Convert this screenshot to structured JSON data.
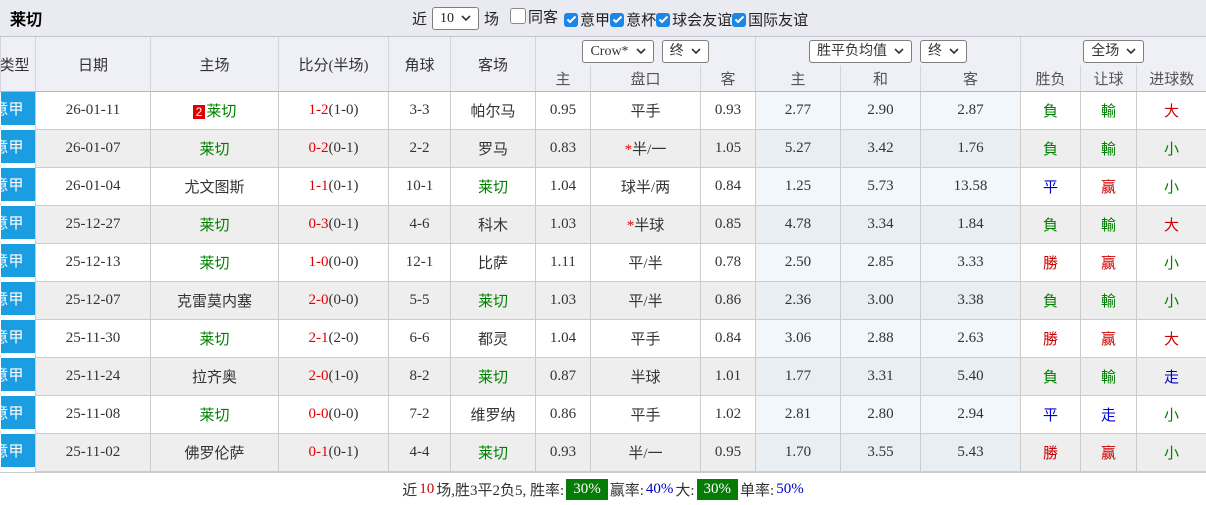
{
  "title": "莱切",
  "filter": {
    "near_label": "近",
    "count": "10",
    "matches_label": "场",
    "checkboxes": [
      {
        "label": "同客",
        "checked": false
      },
      {
        "label": "意甲",
        "checked": true
      },
      {
        "label": "意杯",
        "checked": true
      },
      {
        "label": "球会友谊",
        "checked": true
      },
      {
        "label": "国际友谊",
        "checked": true
      }
    ]
  },
  "table": {
    "selects": {
      "company": "Crow*",
      "stage1": "终",
      "avg": "胜平负均值",
      "stage2": "终",
      "scope": "全场"
    },
    "headers": {
      "type": "类型",
      "date": "日期",
      "home": "主场",
      "score": "比分(半场)",
      "corner": "角球",
      "away": "客场",
      "sub": [
        "主",
        "盘口",
        "客",
        "主",
        "和",
        "客",
        "胜负",
        "让球",
        "进球数"
      ]
    },
    "rows": [
      {
        "league": "意甲",
        "date": "26-01-11",
        "home": {
          "text": "莱切",
          "cls": "g",
          "badge": "2"
        },
        "score": "1-2",
        "half": "(1-0)",
        "corner": "3-3",
        "away": {
          "text": "帕尔马",
          "cls": "k"
        },
        "o1": "0.95",
        "hc": {
          "star": false,
          "text": "平手"
        },
        "o2": "0.93",
        "a1": "2.77",
        "a2": "2.90",
        "a3": "2.87",
        "res": {
          "t": "負",
          "c": "g"
        },
        "hres": {
          "t": "輸",
          "c": "g"
        },
        "gres": {
          "t": "大",
          "c": "r"
        }
      },
      {
        "league": "意甲",
        "date": "26-01-07",
        "home": {
          "text": "莱切",
          "cls": "g",
          "badge": null
        },
        "score": "0-2",
        "half": "(0-1)",
        "corner": "2-2",
        "away": {
          "text": "罗马",
          "cls": "k"
        },
        "o1": "0.83",
        "hc": {
          "star": true,
          "text": "半/一"
        },
        "o2": "1.05",
        "a1": "5.27",
        "a2": "3.42",
        "a3": "1.76",
        "res": {
          "t": "負",
          "c": "g"
        },
        "hres": {
          "t": "輸",
          "c": "g"
        },
        "gres": {
          "t": "小",
          "c": "g"
        }
      },
      {
        "league": "意甲",
        "date": "26-01-04",
        "home": {
          "text": "尤文图斯",
          "cls": "k",
          "badge": null
        },
        "score": "1-1",
        "half": "(0-1)",
        "corner": "10-1",
        "away": {
          "text": "莱切",
          "cls": "g"
        },
        "o1": "1.04",
        "hc": {
          "star": false,
          "text": "球半/两"
        },
        "o2": "0.84",
        "a1": "1.25",
        "a2": "5.73",
        "a3": "13.58",
        "res": {
          "t": "平",
          "c": "b"
        },
        "hres": {
          "t": "赢",
          "c": "r"
        },
        "gres": {
          "t": "小",
          "c": "g"
        }
      },
      {
        "league": "意甲",
        "date": "25-12-27",
        "home": {
          "text": "莱切",
          "cls": "g",
          "badge": null
        },
        "score": "0-3",
        "half": "(0-1)",
        "corner": "4-6",
        "away": {
          "text": "科木",
          "cls": "k"
        },
        "o1": "1.03",
        "hc": {
          "star": true,
          "text": "半球"
        },
        "o2": "0.85",
        "a1": "4.78",
        "a2": "3.34",
        "a3": "1.84",
        "res": {
          "t": "負",
          "c": "g"
        },
        "hres": {
          "t": "輸",
          "c": "g"
        },
        "gres": {
          "t": "大",
          "c": "r"
        }
      },
      {
        "league": "意甲",
        "date": "25-12-13",
        "home": {
          "text": "莱切",
          "cls": "g",
          "badge": null
        },
        "score": "1-0",
        "half": "(0-0)",
        "corner": "12-1",
        "away": {
          "text": "比萨",
          "cls": "k"
        },
        "o1": "1.11",
        "hc": {
          "star": false,
          "text": "平/半"
        },
        "o2": "0.78",
        "a1": "2.50",
        "a2": "2.85",
        "a3": "3.33",
        "res": {
          "t": "勝",
          "c": "r"
        },
        "hres": {
          "t": "赢",
          "c": "r"
        },
        "gres": {
          "t": "小",
          "c": "g"
        }
      },
      {
        "league": "意甲",
        "date": "25-12-07",
        "home": {
          "text": "克雷莫内塞",
          "cls": "k",
          "badge": null
        },
        "score": "2-0",
        "half": "(0-0)",
        "corner": "5-5",
        "away": {
          "text": "莱切",
          "cls": "g"
        },
        "o1": "1.03",
        "hc": {
          "star": false,
          "text": "平/半"
        },
        "o2": "0.86",
        "a1": "2.36",
        "a2": "3.00",
        "a3": "3.38",
        "res": {
          "t": "負",
          "c": "g"
        },
        "hres": {
          "t": "輸",
          "c": "g"
        },
        "gres": {
          "t": "小",
          "c": "g"
        }
      },
      {
        "league": "意甲",
        "date": "25-11-30",
        "home": {
          "text": "莱切",
          "cls": "g",
          "badge": null
        },
        "score": "2-1",
        "half": "(2-0)",
        "corner": "6-6",
        "away": {
          "text": "都灵",
          "cls": "k"
        },
        "o1": "1.04",
        "hc": {
          "star": false,
          "text": "平手"
        },
        "o2": "0.84",
        "a1": "3.06",
        "a2": "2.88",
        "a3": "2.63",
        "res": {
          "t": "勝",
          "c": "r"
        },
        "hres": {
          "t": "赢",
          "c": "r"
        },
        "gres": {
          "t": "大",
          "c": "r"
        }
      },
      {
        "league": "意甲",
        "date": "25-11-24",
        "home": {
          "text": "拉齐奥",
          "cls": "k",
          "badge": null
        },
        "score": "2-0",
        "half": "(1-0)",
        "corner": "8-2",
        "away": {
          "text": "莱切",
          "cls": "g"
        },
        "o1": "0.87",
        "hc": {
          "star": false,
          "text": "半球"
        },
        "o2": "1.01",
        "a1": "1.77",
        "a2": "3.31",
        "a3": "5.40",
        "res": {
          "t": "負",
          "c": "g"
        },
        "hres": {
          "t": "輸",
          "c": "g"
        },
        "gres": {
          "t": "走",
          "c": "b"
        }
      },
      {
        "league": "意甲",
        "date": "25-11-08",
        "home": {
          "text": "莱切",
          "cls": "g",
          "badge": null
        },
        "score": "0-0",
        "half": "(0-0)",
        "corner": "7-2",
        "away": {
          "text": "维罗纳",
          "cls": "k"
        },
        "o1": "0.86",
        "hc": {
          "star": false,
          "text": "平手"
        },
        "o2": "1.02",
        "a1": "2.81",
        "a2": "2.80",
        "a3": "2.94",
        "res": {
          "t": "平",
          "c": "b"
        },
        "hres": {
          "t": "走",
          "c": "b"
        },
        "gres": {
          "t": "小",
          "c": "g"
        }
      },
      {
        "league": "意甲",
        "date": "25-11-02",
        "home": {
          "text": "佛罗伦萨",
          "cls": "k",
          "badge": null
        },
        "score": "0-1",
        "half": "(0-1)",
        "corner": "4-4",
        "away": {
          "text": "莱切",
          "cls": "g"
        },
        "o1": "0.93",
        "hc": {
          "star": false,
          "text": "半/一"
        },
        "o2": "0.95",
        "a1": "1.70",
        "a2": "3.55",
        "a3": "5.43",
        "res": {
          "t": "勝",
          "c": "r"
        },
        "hres": {
          "t": "赢",
          "c": "r"
        },
        "gres": {
          "t": "小",
          "c": "g"
        }
      }
    ]
  },
  "footer": {
    "segments": [
      {
        "t": "近",
        "c": "k"
      },
      {
        "t": "10",
        "c": "r"
      },
      {
        "t": "场,胜3平2负5, 胜率:",
        "c": "k"
      },
      {
        "t": "30%",
        "c": "badge"
      },
      {
        "t": "赢率:",
        "c": "k"
      },
      {
        "t": "40%",
        "c": "b"
      },
      {
        "t": "大:",
        "c": "k"
      },
      {
        "t": "30%",
        "c": "badge"
      },
      {
        "t": "单率:",
        "c": "k"
      },
      {
        "t": "50%",
        "c": "b"
      }
    ]
  }
}
